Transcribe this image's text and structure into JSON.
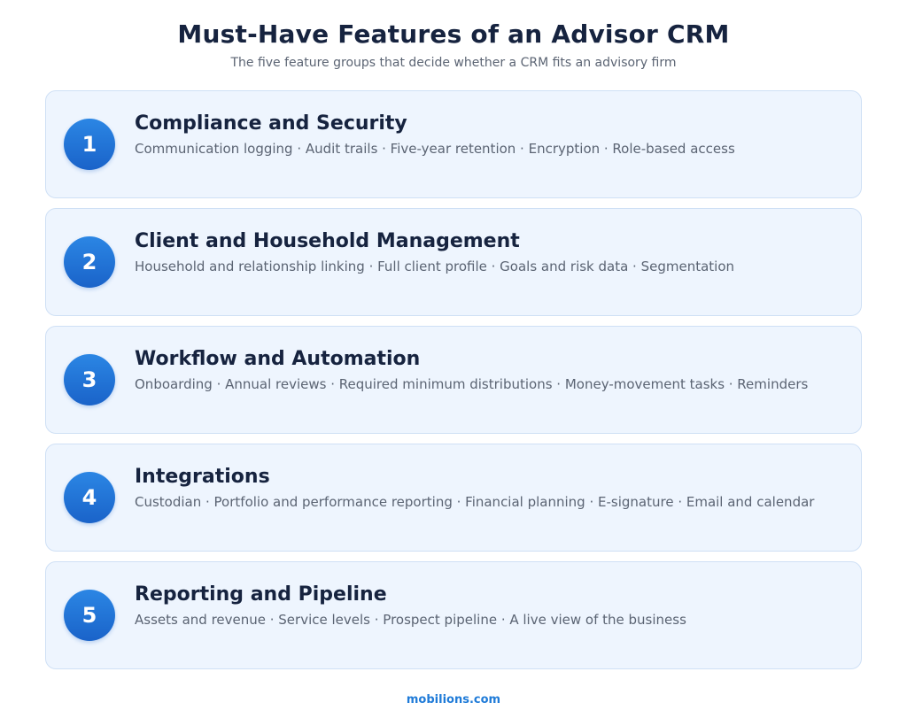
{
  "title": "Must-Have Features of an Advisor CRM",
  "subtitle": "The five feature groups that decide whether a CRM fits an advisory firm",
  "features": [
    {
      "number": "1",
      "title": "Compliance and Security",
      "description": "Communication logging · Audit trails · Five-year retention · Encryption · Role-based access"
    },
    {
      "number": "2",
      "title": "Client and Household Management",
      "description": "Household and relationship linking · Full client profile · Goals and risk data · Segmentation"
    },
    {
      "number": "3",
      "title": "Workflow and Automation",
      "description": "Onboarding · Annual reviews · Required minimum distributions · Money-movement tasks · Reminders"
    },
    {
      "number": "4",
      "title": "Integrations",
      "description": "Custodian · Portfolio and performance reporting · Financial planning · E-signature · Email and calendar"
    },
    {
      "number": "5",
      "title": "Reporting and Pipeline",
      "description": "Assets and revenue · Service levels · Prospect pipeline · A live view of the business"
    }
  ],
  "footer": "mobilions.com",
  "colors": {
    "badge": "#1f74d6",
    "card_background": "#eef5fe",
    "card_border": "#cfe0f5",
    "title_text": "#16233f",
    "body_text": "#5b6473",
    "footer_text": "#1f7bd8"
  }
}
